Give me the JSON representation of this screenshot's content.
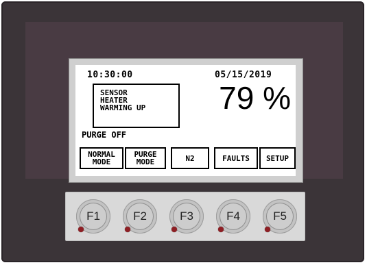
{
  "display": {
    "time": "10:30:00",
    "date": "05/15/2019",
    "message_lines": [
      "SENSOR",
      "HEATER",
      "WARMING UP"
    ],
    "reading": "79 %",
    "purge_status": "PURGE OFF"
  },
  "softkeys": [
    {
      "line1": "NORMAL",
      "line2": "MODE"
    },
    {
      "line1": "PURGE",
      "line2": "MODE"
    },
    {
      "line1": "N2",
      "line2": ""
    },
    {
      "line1": "FAULTS",
      "line2": ""
    },
    {
      "line1": "SETUP",
      "line2": ""
    }
  ],
  "function_keys": [
    {
      "label": "F1"
    },
    {
      "label": "F2"
    },
    {
      "label": "F3"
    },
    {
      "label": "F4"
    },
    {
      "label": "F5"
    }
  ],
  "colors": {
    "device_body": "#3b3438",
    "bezel": "#493b43",
    "led": "#8e1f24",
    "keypad": "#d9d9d9"
  }
}
